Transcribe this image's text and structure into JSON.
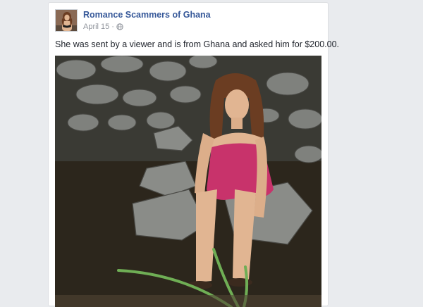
{
  "post": {
    "page_name": "Romance Scammers of Ghana",
    "date": "April 15",
    "separator": "·",
    "privacy_icon": "globe-icon",
    "text": "She was sent by a viewer and is from Ghana and asked him for $200.00."
  },
  "photo": {
    "description_icon": "photo",
    "colors": {
      "rock": "#8a8c88",
      "water": "#2c261c",
      "dress": "#c8336b",
      "skin": "#e1b592",
      "hair": "#6b3d22",
      "grass": "#6fae55"
    }
  }
}
